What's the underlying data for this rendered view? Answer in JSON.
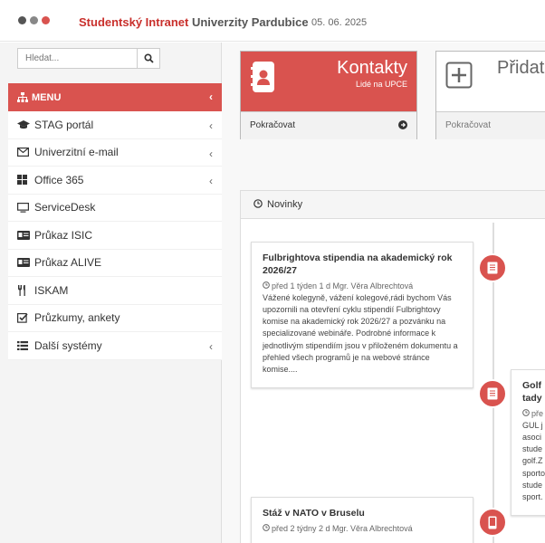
{
  "header": {
    "title_part1": "Studentský Intranet",
    "title_part2": " Univerzity Pardubice",
    "date": "05. 06. 2025",
    "dot_colors": [
      "#555555",
      "#888888",
      "#d9534f"
    ]
  },
  "sidebar": {
    "search_placeholder": "Hledat...",
    "menu_label": "MENU",
    "items": [
      {
        "label": "STAG portál",
        "icon": "graduation-cap-icon",
        "has_chevron": true
      },
      {
        "label": "Univerzitní e-mail",
        "icon": "envelope-icon",
        "has_chevron": true
      },
      {
        "label": "Office 365",
        "icon": "windows-icon",
        "has_chevron": true
      },
      {
        "label": "ServiceDesk",
        "icon": "monitor-icon",
        "has_chevron": false
      },
      {
        "label": "Průkaz ISIC",
        "icon": "id-card-icon",
        "has_chevron": false
      },
      {
        "label": "Průkaz ALIVE",
        "icon": "id-card-icon",
        "has_chevron": false
      },
      {
        "label": "ISKAM",
        "icon": "cutlery-icon",
        "has_chevron": false
      },
      {
        "label": "Průzkumy, ankety",
        "icon": "checkbox-icon",
        "has_chevron": false
      },
      {
        "label": "Další systémy",
        "icon": "list-icon",
        "has_chevron": true
      }
    ]
  },
  "cards": {
    "kontakty": {
      "title": "Kontakty",
      "subtitle": "Lidé na UPCE",
      "footer": "Pokračovat"
    },
    "pridat": {
      "title": "Přidat",
      "footer": "Pokračovat"
    }
  },
  "news": {
    "heading": "Novinky",
    "items": [
      {
        "title": "Fulbrightova stipendia na akademický rok 2026/27",
        "meta": "před 1 týden 1 d Mgr. Věra Albrechtová",
        "body": "Vážené kolegyně, vážení kolegové,rádi bychom Vás upozornili na otevření cyklu stipendií Fulbrightovy komise na akademický rok 2026/27 a pozvánku na specializované webináře. Podrobné informace k jednotlivým stipendiím jsou v přiloženém dokumentu a přehled všech programů je na webové stránce komise...."
      },
      {
        "title": "Golf tady",
        "meta": "pře",
        "body": "GUL j asoci stude golf.Z sporto stude sport."
      },
      {
        "title": "Stáž v NATO v Bruselu",
        "meta": "před 2 týdny 2 d Mgr. Věra Albrechtová",
        "body": ""
      }
    ]
  },
  "colors": {
    "accent": "#d9534f"
  }
}
